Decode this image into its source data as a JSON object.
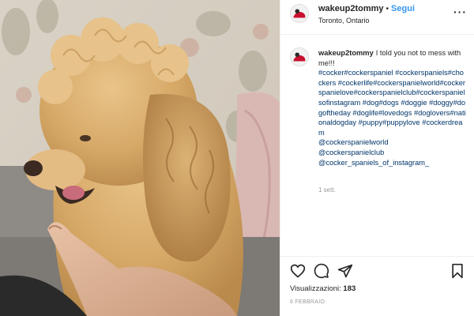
{
  "post": {
    "username": "wakeup2tommy",
    "separator": "•",
    "follow_label": "Segui",
    "location": "Toronto, Ontario",
    "more_label": "···",
    "caption_user": "wakeup2tommy",
    "caption_text": "I told you not to mess with me!!!",
    "caption_hashtags": "#cocker#cockerspaniel #cockerspaniels#chockers #cockerlife#cockerspanielworld#cockerspanielove#cockerspanielclub#cockerspanielsofinstagram #dog#dogs #doggie #doggy#dogoftheday #doglife#lovedogs #doglovers#nationaldogday #puppy#puppylove #cockerdream",
    "mentions": [
      "@cockerspanielworld",
      "@cockerspanielclub",
      "@cocker_spaniels_of_instagram_"
    ],
    "time_ago": "1 sett.",
    "views_label": "Visualizzazioni:",
    "views_count": "183",
    "date": "6 FEBBRAIO"
  },
  "icons": {
    "like": "heart-icon",
    "comment": "comment-icon",
    "share": "share-icon",
    "save": "bookmark-icon"
  },
  "colors": {
    "follow": "#3897f0",
    "hashtag": "#003569",
    "muted": "#999999",
    "text": "#262626"
  }
}
